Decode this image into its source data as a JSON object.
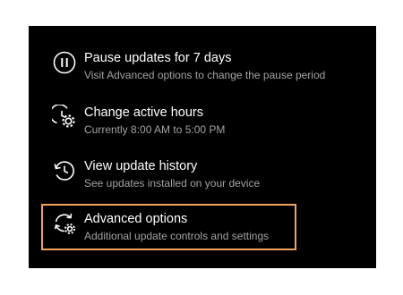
{
  "update_options": [
    {
      "id": "pause",
      "title": "Pause updates for 7 days",
      "description": "Visit Advanced options to change the pause period",
      "icon": "pause-circle-icon"
    },
    {
      "id": "active_hours",
      "title": "Change active hours",
      "description": "Currently 8:00 AM to 5:00 PM",
      "icon": "clock-gear-icon"
    },
    {
      "id": "history",
      "title": "View update history",
      "description": "See updates installed on your device",
      "icon": "history-icon"
    },
    {
      "id": "advanced",
      "title": "Advanced options",
      "description": "Additional update controls and settings",
      "icon": "sync-gear-icon",
      "highlighted": true
    }
  ],
  "colors": {
    "panel_background": "#000000",
    "title_text": "#ffffff",
    "description_text": "#a3a3a3",
    "highlight_border": "#f0a35f"
  }
}
